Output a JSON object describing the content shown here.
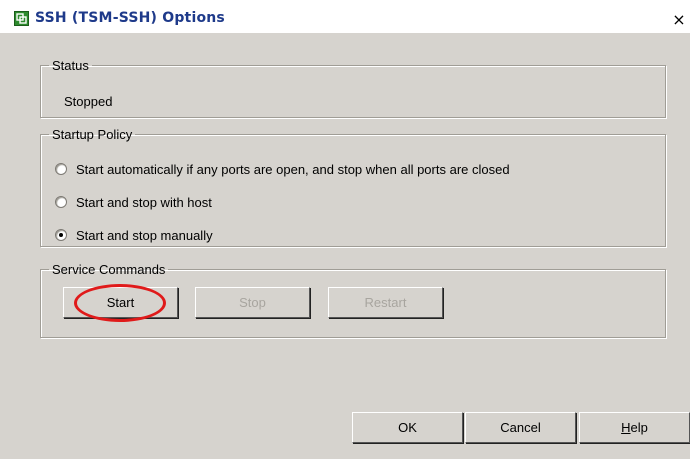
{
  "window": {
    "title": "SSH (TSM-SSH) Options",
    "close_glyph": "×",
    "icon": "vsphere-app-icon"
  },
  "status": {
    "legend": "Status",
    "value": "Stopped"
  },
  "startup_policy": {
    "legend": "Startup Policy",
    "options": [
      {
        "label": "Start automatically if any ports are open, and stop when all ports are closed",
        "checked": false
      },
      {
        "label": "Start and stop with host",
        "checked": false
      },
      {
        "label": "Start and stop manually",
        "checked": true
      }
    ]
  },
  "service_commands": {
    "legend": "Service Commands",
    "start_label": "Start",
    "stop_label": "Stop",
    "restart_label": "Restart",
    "stop_enabled": false,
    "restart_enabled": false
  },
  "footer": {
    "ok_label": "OK",
    "cancel_label": "Cancel",
    "help_first": "H",
    "help_rest": "elp"
  },
  "annotation": {
    "color": "#e01a1a",
    "target": "start-button"
  }
}
